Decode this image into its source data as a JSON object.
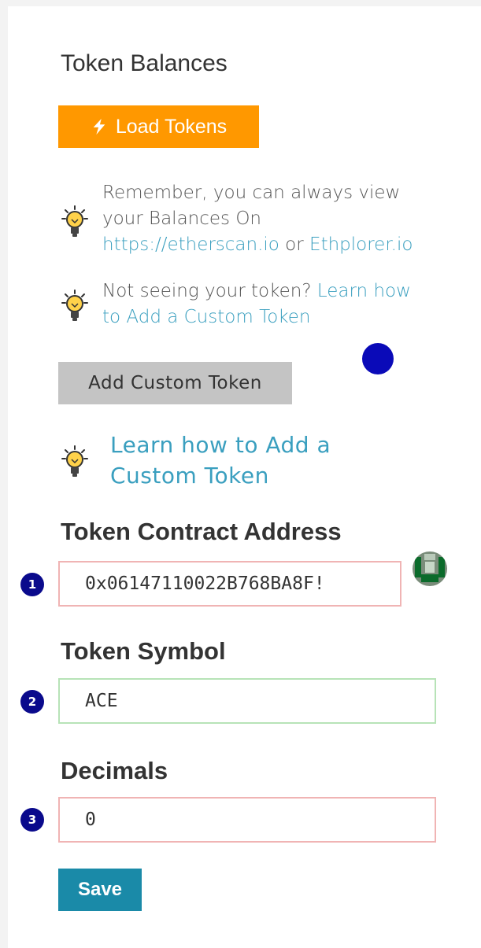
{
  "heading": "Token Balances",
  "load_button": {
    "label": "Load Tokens"
  },
  "tip1": {
    "line1": "Remember, you can always view",
    "line2": "your Balances On",
    "link1": "https://etherscan.io",
    "connector": " or ",
    "link2": "Ethplorer.io"
  },
  "tip2": {
    "text": "Not seeing your token? ",
    "link_line1": "Learn how",
    "link_line2": "to Add a Custom Token"
  },
  "custom_button": {
    "label": "Add Custom Token"
  },
  "learn_link": {
    "line1": "Learn how to Add a",
    "line2": "Custom Token"
  },
  "form": {
    "address": {
      "label": "Token Contract Address",
      "value": "0x06147110022B768BA8F!",
      "step": "1"
    },
    "symbol": {
      "label": "Token Symbol",
      "value": "ACE",
      "step": "2"
    },
    "decimals": {
      "label": "Decimals",
      "value": "0",
      "step": "3"
    }
  },
  "save_button": {
    "label": "Save"
  },
  "colors": {
    "orange": "#ff9800",
    "link": "#3a9fbf",
    "save": "#1a8aa8",
    "badge": "#0a0a8c"
  }
}
